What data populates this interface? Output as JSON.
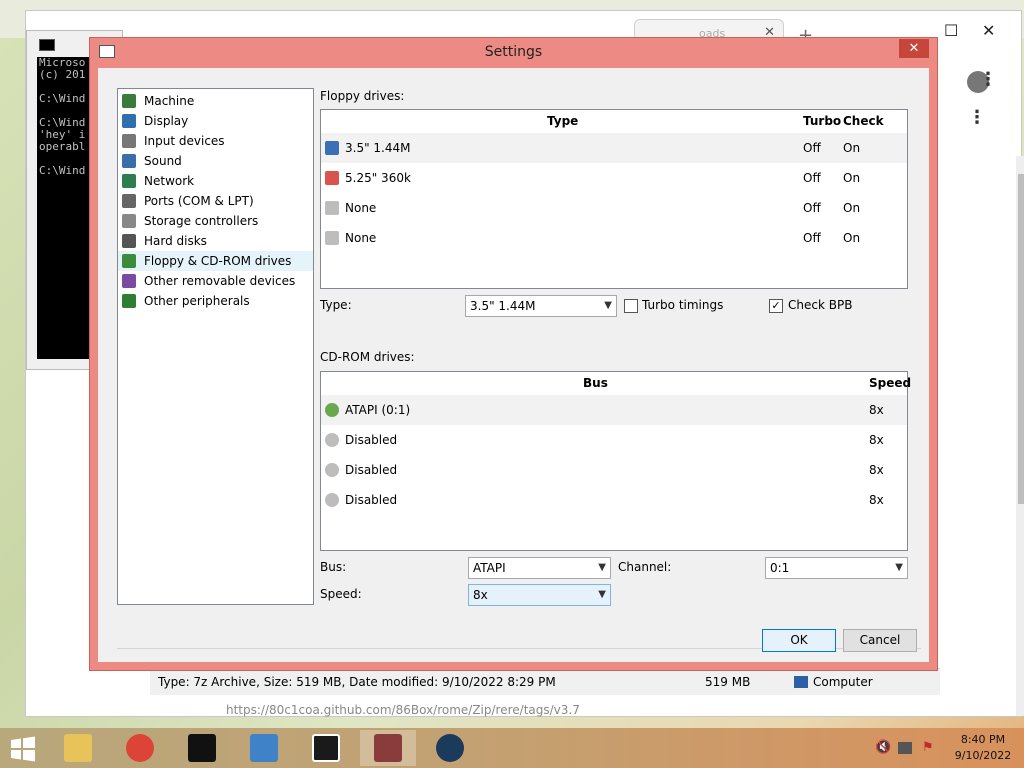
{
  "background": {
    "cmd_lines": [
      "Microso",
      "(c) 201",
      "",
      "C:\\Wind",
      "",
      "C:\\Wind",
      "'hey' i",
      "operabl",
      "",
      "C:\\Wind"
    ],
    "status": {
      "type_info": "Type: 7z Archive, Size: 519 MB, Date modified: 9/10/2022 8:29 PM",
      "size": "519 MB",
      "location": "Computer"
    },
    "url_text": "https://80c1coa.github.com/86Box/rome/Zip/rere/tags/v3.7",
    "tab_label": "oads"
  },
  "dialog": {
    "title": "Settings",
    "close_glyph": "✕",
    "tree_items": [
      {
        "label": "Machine",
        "icon": "machine-icon",
        "color": "#3a7a3a"
      },
      {
        "label": "Display",
        "icon": "display-icon",
        "color": "#2f6fb0"
      },
      {
        "label": "Input devices",
        "icon": "input-devices-icon",
        "color": "#777777"
      },
      {
        "label": "Sound",
        "icon": "sound-icon",
        "color": "#3a6ea8"
      },
      {
        "label": "Network",
        "icon": "network-icon",
        "color": "#2e7d4f"
      },
      {
        "label": "Ports (COM & LPT)",
        "icon": "ports-icon",
        "color": "#666666"
      },
      {
        "label": "Storage controllers",
        "icon": "storage-controllers-icon",
        "color": "#888888"
      },
      {
        "label": "Hard disks",
        "icon": "hard-disks-icon",
        "color": "#555555"
      },
      {
        "label": "Floppy & CD-ROM drives",
        "icon": "floppy-cdrom-icon",
        "color": "#3c8c3c"
      },
      {
        "label": "Other removable devices",
        "icon": "removable-devices-icon",
        "color": "#7a4aa0"
      },
      {
        "label": "Other peripherals",
        "icon": "peripherals-icon",
        "color": "#2e7d32"
      }
    ],
    "selected_index": 8,
    "floppy": {
      "section_label": "Floppy drives:",
      "headers": {
        "type": "Type",
        "turbo": "Turbo",
        "check_bpb": "Check BPB"
      },
      "rows": [
        {
          "type": "3.5\" 1.44M",
          "turbo": "Off",
          "bpb": "On",
          "icon": "floppy-35-icon"
        },
        {
          "type": "5.25\" 360k",
          "turbo": "Off",
          "bpb": "On",
          "icon": "floppy-525-icon"
        },
        {
          "type": "None",
          "turbo": "Off",
          "bpb": "On",
          "icon": "floppy-none-icon"
        },
        {
          "type": "None",
          "turbo": "Off",
          "bpb": "On",
          "icon": "floppy-none-icon"
        }
      ],
      "type_label": "Type:",
      "type_value": "3.5\" 1.44M",
      "turbo_label": "Turbo timings",
      "turbo_checked": false,
      "checkbpb_label": "Check BPB",
      "checkbpb_checked": true
    },
    "cdrom": {
      "section_label": "CD-ROM drives:",
      "headers": {
        "bus": "Bus",
        "speed": "Speed"
      },
      "rows": [
        {
          "bus": "ATAPI (0:1)",
          "speed": "8x",
          "icon": "cdrom-icon"
        },
        {
          "bus": "Disabled",
          "speed": "8x",
          "icon": "cdrom-disabled-icon"
        },
        {
          "bus": "Disabled",
          "speed": "8x",
          "icon": "cdrom-disabled-icon"
        },
        {
          "bus": "Disabled",
          "speed": "8x",
          "icon": "cdrom-disabled-icon"
        }
      ],
      "bus_label": "Bus:",
      "bus_value": "ATAPI",
      "channel_label": "Channel:",
      "channel_value": "0:1",
      "speed_label": "Speed:",
      "speed_value": "8x"
    },
    "ok_label": "OK",
    "cancel_label": "Cancel"
  },
  "taskbar": {
    "items": [
      "file-explorer-icon",
      "chrome-icon",
      "command-prompt-icon",
      "registry-icon",
      "7zip-icon",
      "86box-icon",
      "steam-icon"
    ],
    "time": "8:40 PM",
    "date": "9/10/2022"
  },
  "colors": {
    "dialog_frame": "#ec8a83",
    "close_button": "#c7463b",
    "taskbar": "#c4a071"
  }
}
